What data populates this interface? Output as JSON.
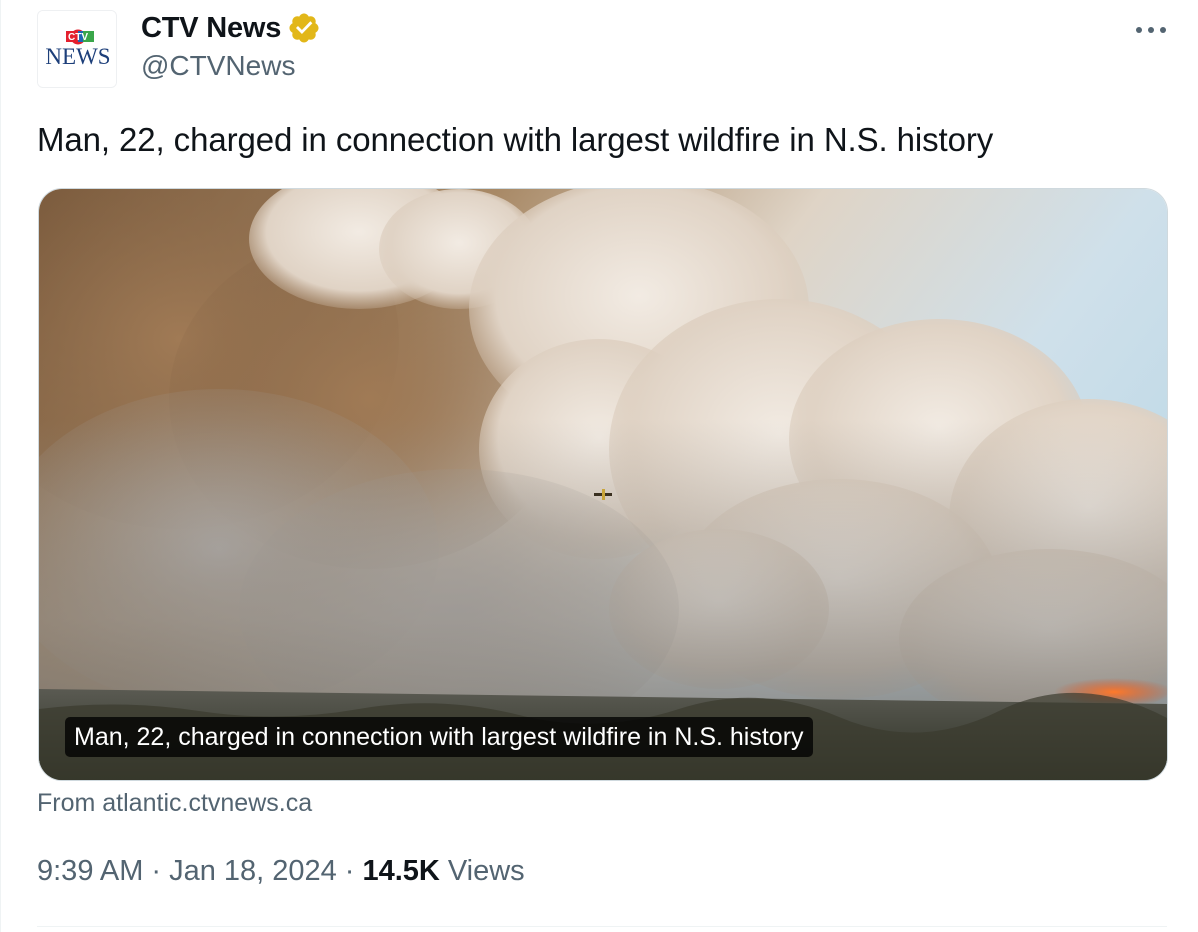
{
  "author": {
    "display_name": "CTV News",
    "handle": "@CTVNews",
    "verified": true,
    "logo": {
      "top_text": "CTV",
      "bottom_text": "NEWS"
    }
  },
  "tweet": {
    "text": "Man, 22, charged in connection with largest wildfire in N.S. history"
  },
  "card": {
    "image_description": "wildfire smoke photo",
    "caption": "Man, 22, charged in connection with largest wildfire in N.S. history",
    "source_prefix": "From",
    "source_domain": "atlantic.ctvnews.ca"
  },
  "meta": {
    "time": "9:39 AM",
    "separator": "·",
    "date": "Jan 18, 2024",
    "views_count": "14.5K",
    "views_label": "Views"
  },
  "icons": {
    "verified": "verified-badge-icon",
    "more": "more-horizontal-icon"
  },
  "colors": {
    "verified_gold": "#e2b719",
    "secondary_text": "#536471",
    "primary_text": "#0f1419",
    "ctv_red": "#e4202e",
    "ctv_blue": "#1f66b3",
    "ctv_green": "#3aa64a"
  }
}
